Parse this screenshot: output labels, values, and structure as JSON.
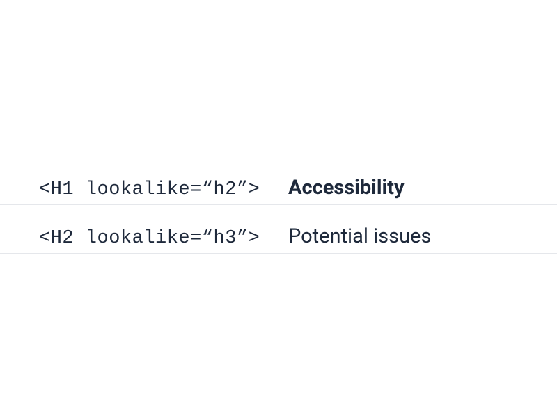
{
  "rows": [
    {
      "code": "<H1 lookalike=“h2”>",
      "heading": "Accessibility",
      "weight": "bold"
    },
    {
      "code": "<H2 lookalike=“h3”>",
      "heading": "Potential issues",
      "weight": "regular"
    }
  ]
}
